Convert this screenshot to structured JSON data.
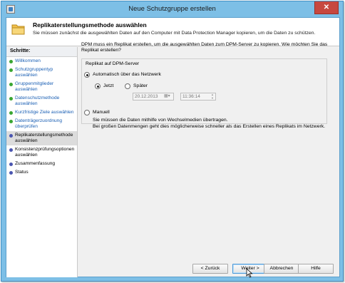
{
  "window": {
    "title": "Neue Schutzgruppe erstellen",
    "close_label": "✕"
  },
  "header": {
    "title": "Replikaterstellungsmethode auswählen",
    "subtitle": "Sie müssen zunächst die ausgewählten Daten auf den Computer mit Data Protection Manager kopieren, um die Daten zu schützen."
  },
  "sidebar": {
    "heading": "Schritte:",
    "steps": [
      {
        "label": "Willkommen",
        "state": "done"
      },
      {
        "label": "Schutzgruppentyp auswählen",
        "state": "done"
      },
      {
        "label": "Gruppenmitglieder auswählen",
        "state": "done"
      },
      {
        "label": "Datenschutzmethode auswählen",
        "state": "done"
      },
      {
        "label": "Kurzfristige Ziele auswählen",
        "state": "done"
      },
      {
        "label": "Datenträgerzuordnung überprüfen",
        "state": "done"
      },
      {
        "label": "Replikaterstellungsmethode auswählen",
        "state": "current"
      },
      {
        "label": "Konsistenzprüfungsoptionen auswählen",
        "state": "pending"
      },
      {
        "label": "Zusammenfassung",
        "state": "pending"
      },
      {
        "label": "Status",
        "state": "pending"
      }
    ]
  },
  "main": {
    "intro": "DPM muss ein Replikat erstellen, um die ausgewählten Daten zum DPM-Server zu kopieren. Wie möchten Sie das Replikat erstellen?",
    "group_label": "Replikat auf DPM-Server",
    "auto_label": "Automatisch über das Netzwerk",
    "now_label": "Jetzt",
    "later_label": "Später",
    "date_value": "20.12.2013",
    "time_value": "11:36:14",
    "manual_label": "Manuell",
    "manual_desc_1": "Sie müssen die Daten mithilfe von Wechselmedien übertragen.",
    "manual_desc_2": "Bei großen Datenmengen geht dies möglicherweise schneller als das Erstellen eines Replikats im Netzwerk."
  },
  "buttons": {
    "back": "< Zurück",
    "next": "Weiter >",
    "cancel": "Abbrechen",
    "help": "Hilfe"
  },
  "colors": {
    "accent_frame": "#7dbfe6",
    "done_dot": "#3aa632",
    "pending_dot": "#4a55b0",
    "link": "#1a5fb4"
  }
}
